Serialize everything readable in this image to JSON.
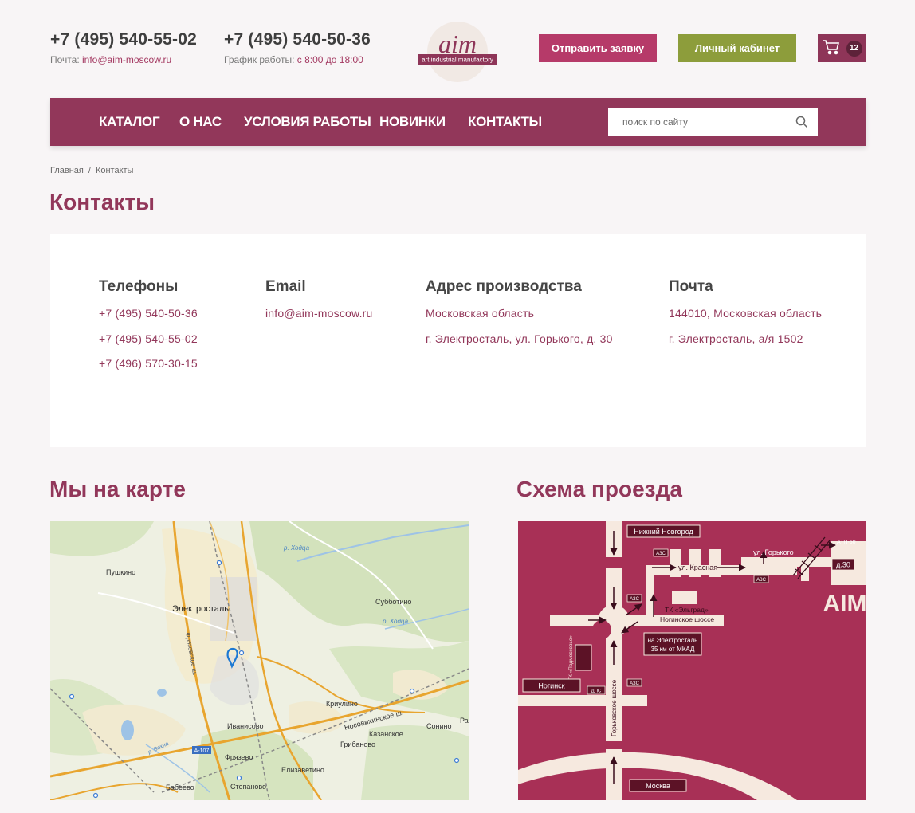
{
  "header": {
    "phone1": "+7 (495) 540-55-02",
    "phone1_sub_label": "Почта: ",
    "phone1_sub_value": "info@aim-moscow.ru",
    "phone2": "+7 (495) 540-50-36",
    "phone2_sub_label": "График работы: ",
    "phone2_sub_value": "с 8:00 до 18:00",
    "logo_text": "aim",
    "logo_tagline": "art industrial manufactory",
    "request_button": "Отправить заявку",
    "cabinet_button": "Личный кабинет",
    "cart_count": "12",
    "cart_icon": "cart-icon"
  },
  "nav": {
    "items": [
      "КАТАЛОГ",
      "О НАС",
      "УСЛОВИЯ РАБОТЫ",
      "НОВИНКИ",
      "КОНТАКТЫ"
    ],
    "search_placeholder": "поиск по сайту",
    "search_icon": "search-icon"
  },
  "breadcrumb": {
    "home": "Главная",
    "separator": "/",
    "current": "Контакты"
  },
  "page_title": "Контакты",
  "contacts": {
    "phones_title": "Телефоны",
    "phones": [
      "+7 (495) 540-50-36",
      "+7 (495) 540-55-02",
      "+7 (496) 570-30-15"
    ],
    "email_title": "Email",
    "email": "info@aim-moscow.ru",
    "address_title": "Адрес производства",
    "address_lines": [
      "Московская область",
      "г. Электросталь, ул. Горького, д. 30"
    ],
    "post_title": "Почта",
    "post_lines": [
      "144010, Московская область",
      "г. Электросталь, а/я 1502"
    ]
  },
  "map_section": {
    "title": "Мы на карте",
    "labels": {
      "pushkino": "Пушкино",
      "elektrostal": "Электросталь",
      "subbotino": "Субботино",
      "khodtsa": "р. Ходца",
      "khodtsa2": "р. Ходца",
      "fryazevskoe": "Фрязевское ш.",
      "krupino": "Криулино",
      "ivanisovo": "Иванисово",
      "nosovikhinskoe": "Носовихинское ш.",
      "kazanskoe": "Казанское",
      "sonino": "Сонино",
      "gribanovo": "Грибаново",
      "a107": "А-107",
      "fryazevo": "Фрязево",
      "vokhna": "р. Вохна",
      "elizavetino": "Елизаветино",
      "babeevo": "Бабеево",
      "stepanovo": "Степаново",
      "ra": "Ра"
    },
    "marker_icon": "map-pin-icon"
  },
  "scheme_section": {
    "title": "Схема проезда",
    "labels": {
      "nizhny": "Нижний Новгород",
      "azs1": "АЗС",
      "gorkogo": "ул. Горького",
      "atp": "АТП-50",
      "krasnaya": "ул. Красная",
      "azs2": "АЗС",
      "d30": "д.30",
      "azs3": "АЗС",
      "aim": "AIM",
      "eldgrad": "ТК «Эльград»",
      "noginskoe": "Ногинское шоссе",
      "to_elektrostal_1": "на Электросталь",
      "to_elektrostal_2": "35 км от МКАД",
      "tk_podmoskovie": "ТК «Подмосковье»",
      "noginsk": "Ногинск",
      "dps": "ДПС",
      "azs4": "АЗС",
      "gorkovskoe": "Горьковское шоссе",
      "moskva": "Москва"
    }
  }
}
